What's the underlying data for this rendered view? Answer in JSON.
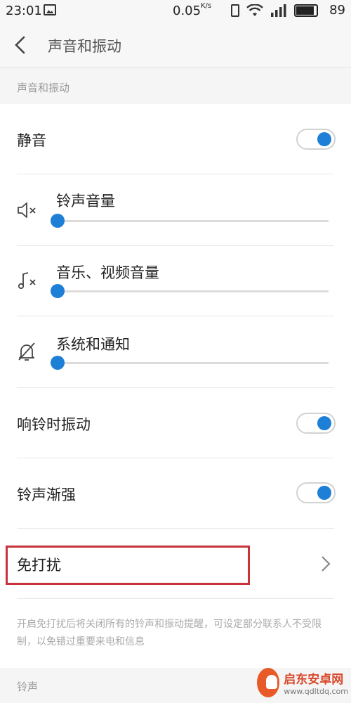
{
  "status_bar": {
    "time": "23:01",
    "net_speed": "0.05",
    "net_speed_unit": "K/s",
    "battery": "89",
    "battery_level_percent": 89
  },
  "app_bar": {
    "title": "声音和振动"
  },
  "section_sound": {
    "header": "声音和振动"
  },
  "mute": {
    "label": "静音",
    "on": true
  },
  "volumes": [
    {
      "label": "铃声音量",
      "icon": "speaker-mute-icon",
      "level_percent": 0
    },
    {
      "label": "音乐、视频音量",
      "icon": "music-note-mute-icon",
      "level_percent": 0
    },
    {
      "label": "系统和通知",
      "icon": "bell-off-icon",
      "level_percent": 0
    }
  ],
  "vibrate_on_ring": {
    "label": "响铃时振动",
    "on": true
  },
  "ring_crescendo": {
    "label": "铃声渐强",
    "on": true
  },
  "dnd": {
    "label": "免打扰"
  },
  "dnd_description": "开启免打扰后将关闭所有的铃声和振动提醒，可设定部分联系人不受限制，以免错过重要来电和信息",
  "section_ringtone": {
    "header": "铃声"
  },
  "watermark": {
    "name": "启东安卓网",
    "url": "www.qdltdq.com"
  },
  "colors": {
    "accent": "#1e7fd6",
    "highlight": "#c8323a",
    "muted_text": "#aaaaaa"
  }
}
